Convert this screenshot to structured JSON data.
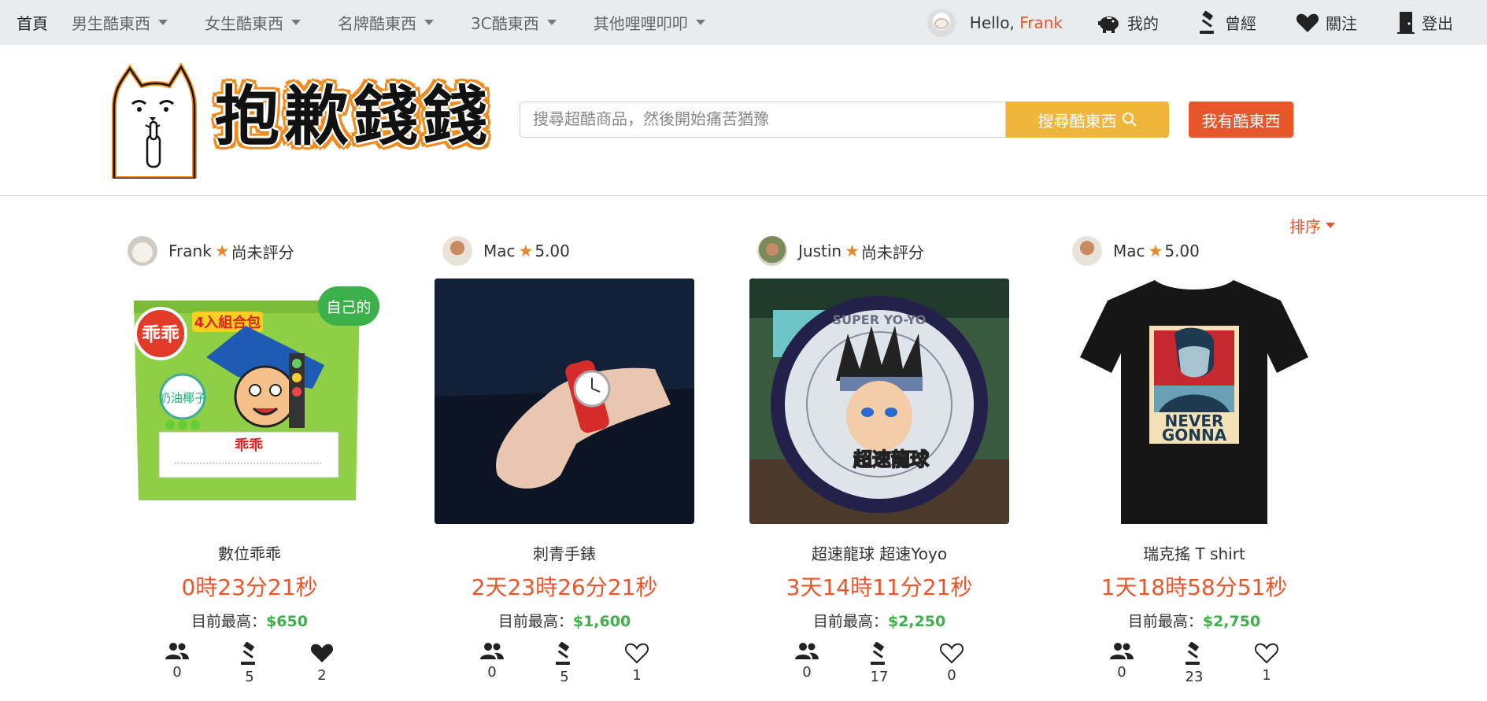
{
  "nav": {
    "home": "首頁",
    "categories": [
      "男生酷東西",
      "女生酷東西",
      "名牌酷東西",
      "3C酷東西",
      "其他哩哩叩叩"
    ],
    "hello_prefix": "Hello, ",
    "username": "Frank",
    "links": {
      "mine": "我的",
      "history": "曾經",
      "follow": "關注",
      "logout": "登出"
    }
  },
  "header": {
    "logo_text": [
      "抱",
      "歉",
      "錢",
      "錢"
    ],
    "search_placeholder": "搜尋超酷商品，然後開始痛苦猶豫",
    "search_button": "搜尋酷東西",
    "sell_button": "我有酷東西"
  },
  "sort_label": "排序",
  "price_label": "目前最高：",
  "colors": {
    "accent_orange": "#e8562a",
    "search_yellow": "#f0b63a",
    "price_green": "#3cb04a",
    "nav_bg": "#e9ecef"
  },
  "cards": [
    {
      "seller": "Frank",
      "rating": "尚未評分",
      "own_badge": "自己的",
      "title": "數位乖乖",
      "timer": "0時23分21秒",
      "price": "$650",
      "bidders": "0",
      "bids": "5",
      "likes": "2",
      "liked": true,
      "image": "snack-bag"
    },
    {
      "seller": "Mac",
      "rating": "5.00",
      "title": "刺青手錶",
      "timer": "2天23時26分21秒",
      "price": "$1,600",
      "bidders": "0",
      "bids": "5",
      "likes": "1",
      "liked": false,
      "image": "wrist-watch"
    },
    {
      "seller": "Justin",
      "rating": "尚未評分",
      "title": "超速龍球 超速Yoyo",
      "timer": "3天14時11分21秒",
      "price": "$2,250",
      "bidders": "0",
      "bids": "17",
      "likes": "0",
      "liked": false,
      "image": "yoyo"
    },
    {
      "seller": "Mac",
      "rating": "5.00",
      "title": "瑞克搖 T shirt",
      "timer": "1天18時58分51秒",
      "price": "$2,750",
      "bidders": "0",
      "bids": "23",
      "likes": "1",
      "liked": false,
      "image": "t-shirt"
    }
  ],
  "image_text": {
    "snack_brand": "乖乖",
    "snack_pack": "4入組合包",
    "snack_flavor": "奶油椰子",
    "snack_label": "乖乖",
    "yoyo_ring": "SUPER YO-YO",
    "yoyo_title": "超速龍球",
    "shirt_line1": "NEVER",
    "shirt_line2": "GONNA"
  }
}
